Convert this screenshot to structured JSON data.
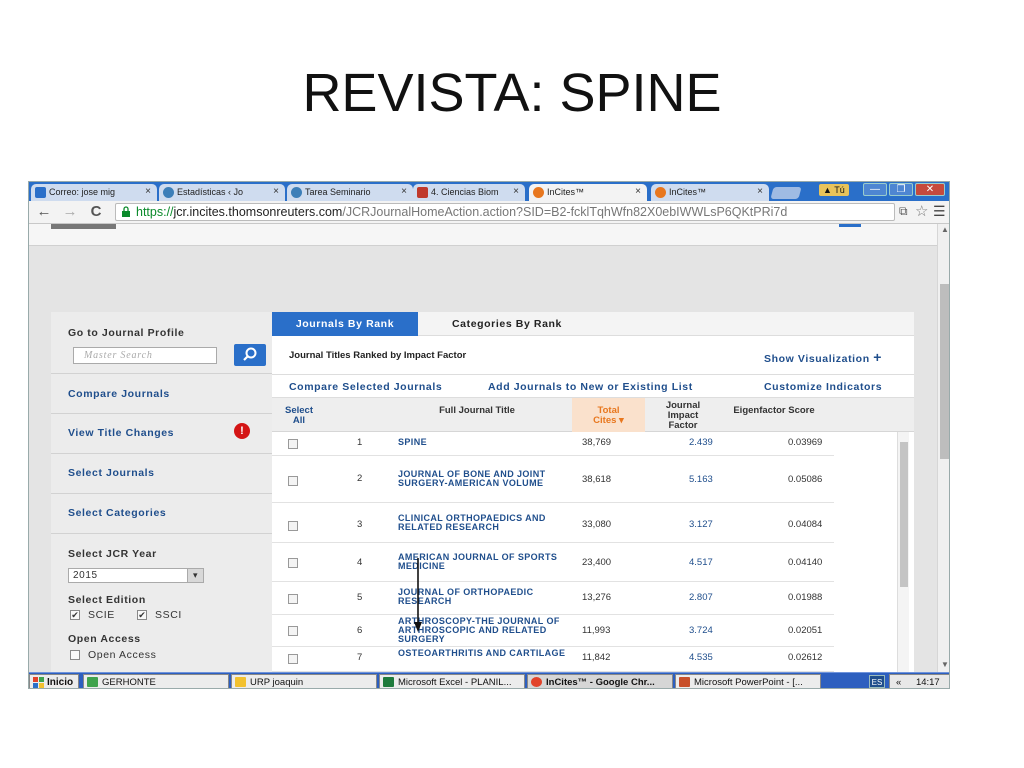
{
  "slide": {
    "title": "REVISTA: SPINE"
  },
  "browser": {
    "tabs": [
      {
        "label": "Correo: jose mig",
        "icon": "outlook-icon",
        "color": "#2a6fc9"
      },
      {
        "label": "Estadísticas ‹ Jo",
        "icon": "wordpress-icon",
        "color": "#3d7fb8"
      },
      {
        "label": "Tarea Seminario",
        "icon": "wordpress-icon",
        "color": "#3d7fb8"
      },
      {
        "label": "4. Ciencias Biom",
        "icon": "urp-icon",
        "color": "#c0392b"
      },
      {
        "label": "InCites™",
        "icon": "incites-icon",
        "color": "#e8771e",
        "active": true
      },
      {
        "label": "InCites™",
        "icon": "incites-icon",
        "color": "#e8771e"
      }
    ],
    "tab_close": "×",
    "user": "Tú",
    "window_buttons": {
      "minimize": "—",
      "maximize": "❐",
      "close": "✕"
    },
    "nav": {
      "back": "←",
      "forward": "→",
      "reload": "C"
    },
    "url": {
      "scheme": "https://",
      "host": "jcr.incites.thomsonreuters.com",
      "path": "/JCRJournalHomeAction.action?SID=B2-fcklTqhWfn82X0ebIWWLsP6QKtPRi7d"
    },
    "page_action": "⧉",
    "star": "☆",
    "menu": "☰"
  },
  "sidebar": {
    "go_to_profile": "Go to Journal Profile",
    "search_placeholder": "Master Search",
    "compare_journals": "Compare Journals",
    "view_title_changes": "View Title Changes",
    "alert": "!",
    "select_journals": "Select Journals",
    "select_categories": "Select Categories",
    "select_jcr_year": "Select JCR Year",
    "year_value": "2015",
    "select_edition": "Select Edition",
    "edition_scie": "SCIE",
    "edition_ssci": "SSCI",
    "open_access_heading": "Open Access",
    "open_access_option": "Open Access",
    "check_mark": "✔"
  },
  "main": {
    "tab_journals_by_rank": "Journals By Rank",
    "tab_categories_by_rank": "Categories By Rank",
    "ranked_label": "Journal Titles Ranked by Impact Factor",
    "show_visualization": "Show Visualization",
    "plus": "+",
    "compare_selected": "Compare Selected Journals",
    "add_journals": "Add Journals to New or Existing List",
    "customize_indicators": "Customize Indicators",
    "columns": {
      "select_all_1": "Select",
      "select_all_2": "All",
      "full_title": "Full Journal Title",
      "total_cites_1": "Total",
      "total_cites_2": "Cites ▾",
      "jif_1": "Journal",
      "jif_2": "Impact",
      "jif_3": "Factor",
      "eigenfactor": "Eigenfactor Score"
    },
    "rows": [
      {
        "rank": "1",
        "title": "SPINE",
        "cites": "38,769",
        "jif": "2.439",
        "eigen": "0.03969"
      },
      {
        "rank": "2",
        "title": "JOURNAL OF BONE AND JOINT SURGERY-AMERICAN VOLUME",
        "cites": "38,618",
        "jif": "5.163",
        "eigen": "0.05086"
      },
      {
        "rank": "3",
        "title": "CLINICAL ORTHOPAEDICS AND RELATED RESEARCH",
        "cites": "33,080",
        "jif": "3.127",
        "eigen": "0.04084"
      },
      {
        "rank": "4",
        "title": "AMERICAN JOURNAL OF SPORTS MEDICINE",
        "cites": "23,400",
        "jif": "4.517",
        "eigen": "0.04140"
      },
      {
        "rank": "5",
        "title": "JOURNAL OF ORTHOPAEDIC RESEARCH",
        "cites": "13,276",
        "jif": "2.807",
        "eigen": "0.01988"
      },
      {
        "rank": "6",
        "title": "ARTHROSCOPY-THE JOURNAL OF ARTHROSCOPIC AND RELATED SURGERY",
        "cites": "11,993",
        "jif": "3.724",
        "eigen": "0.02051"
      },
      {
        "rank": "7",
        "title": "OSTEOARTHRITIS AND CARTILAGE",
        "cites": "11,842",
        "jif": "4.535",
        "eigen": "0.02612"
      }
    ]
  },
  "taskbar": {
    "start": "Inicio",
    "items": [
      {
        "label": "GERHONTE",
        "icon": "network-icon"
      },
      {
        "label": "URP joaquin",
        "icon": "folder-icon"
      },
      {
        "label": "Microsoft Excel - PLANIL...",
        "icon": "excel-icon"
      },
      {
        "label": "InCites™ - Google Chr...",
        "icon": "chrome-icon",
        "active": true
      },
      {
        "label": "Microsoft PowerPoint - [...",
        "icon": "powerpoint-icon"
      }
    ],
    "lang": "ES",
    "tray_arrows": "«",
    "clock": "14:17"
  },
  "colors": {
    "accent": "#2a6fc9",
    "link": "#1f4e8c",
    "sort_highlight": "#fae1cc",
    "sorted_text": "#e8771e",
    "alert": "#d41515"
  }
}
